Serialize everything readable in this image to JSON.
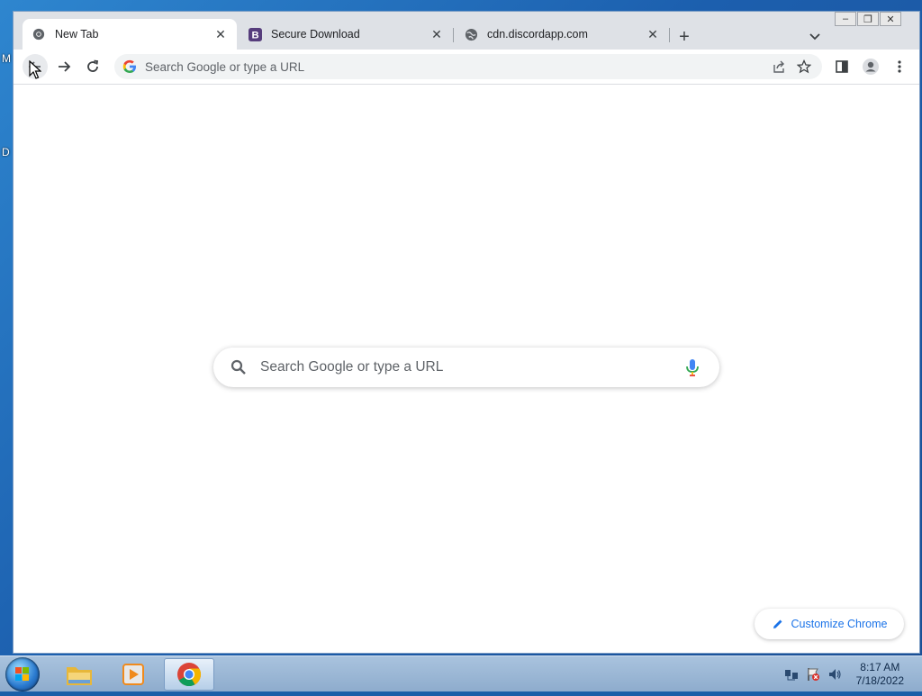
{
  "desktop": {
    "glyphs": [
      "M",
      "D"
    ]
  },
  "window": {
    "controls": {
      "minimize": "–",
      "restore": "❐",
      "close": "✕"
    }
  },
  "tabs": [
    {
      "title": "New Tab",
      "icon": "chrome-icon",
      "active": true
    },
    {
      "title": "Secure Download",
      "icon": "bootstrap-b-icon",
      "active": false
    },
    {
      "title": "cdn.discordapp.com",
      "icon": "globe-icon",
      "active": false
    }
  ],
  "toolbar": {
    "omnibox_placeholder": "Search Google or type a URL"
  },
  "ntp": {
    "search_placeholder": "Search Google or type a URL",
    "customize_label": "Customize Chrome"
  },
  "taskbar": {
    "apps": [
      "explorer-icon",
      "media-player-icon",
      "chrome-icon"
    ],
    "clock_time": "8:17 AM",
    "clock_date": "7/18/2022"
  },
  "colors": {
    "accent": "#1a73e8",
    "tabstrip": "#dee1e6",
    "omnibox": "#f1f3f4"
  }
}
